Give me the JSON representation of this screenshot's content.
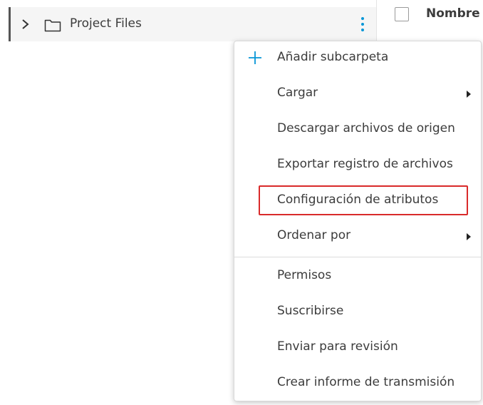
{
  "tree": {
    "folder_label": "Project Files"
  },
  "table": {
    "column_name": "Nombre"
  },
  "menu": {
    "items": [
      {
        "label": "Añadir subcarpeta",
        "icon": "plus-icon"
      },
      {
        "label": "Cargar",
        "submenu": true
      },
      {
        "label": "Descargar archivos de origen"
      },
      {
        "label": "Exportar registro de archivos"
      },
      {
        "label": "Configuración de atributos",
        "highlighted": true
      },
      {
        "label": "Ordenar por",
        "submenu": true
      },
      {
        "label": "Permisos"
      },
      {
        "label": "Suscribirse"
      },
      {
        "label": "Enviar para revisión"
      },
      {
        "label": "Crear informe de transmisión"
      }
    ]
  },
  "colors": {
    "accent": "#0696d7",
    "highlight_border": "#d92a2a",
    "text": "#3c3c3c"
  }
}
